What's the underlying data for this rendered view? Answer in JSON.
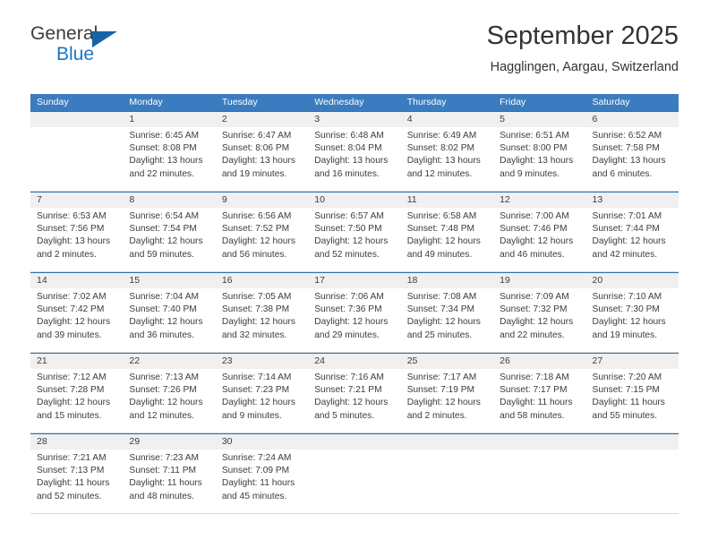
{
  "brand": {
    "name_top": "General",
    "name_bottom": "Blue",
    "triangle_icon": "triangle-icon",
    "color_dark": "#3a3a3a",
    "color_blue": "#1a75c4"
  },
  "header": {
    "title": "September 2025",
    "subtitle": "Hagglingen, Aargau, Switzerland"
  },
  "theme": {
    "header_bar": "#3a7cbf",
    "week_divider": "#2f6fae",
    "daynum_band": "#f0f0f0",
    "text": "#3c3c3c"
  },
  "weekdays": [
    "Sunday",
    "Monday",
    "Tuesday",
    "Wednesday",
    "Thursday",
    "Friday",
    "Saturday"
  ],
  "weeks": [
    {
      "days": [
        {
          "num": "",
          "sunrise": "",
          "sunset": "",
          "daylight_line1": "",
          "daylight_line2": ""
        },
        {
          "num": "1",
          "sunrise": "Sunrise: 6:45 AM",
          "sunset": "Sunset: 8:08 PM",
          "daylight_line1": "Daylight: 13 hours",
          "daylight_line2": "and 22 minutes."
        },
        {
          "num": "2",
          "sunrise": "Sunrise: 6:47 AM",
          "sunset": "Sunset: 8:06 PM",
          "daylight_line1": "Daylight: 13 hours",
          "daylight_line2": "and 19 minutes."
        },
        {
          "num": "3",
          "sunrise": "Sunrise: 6:48 AM",
          "sunset": "Sunset: 8:04 PM",
          "daylight_line1": "Daylight: 13 hours",
          "daylight_line2": "and 16 minutes."
        },
        {
          "num": "4",
          "sunrise": "Sunrise: 6:49 AM",
          "sunset": "Sunset: 8:02 PM",
          "daylight_line1": "Daylight: 13 hours",
          "daylight_line2": "and 12 minutes."
        },
        {
          "num": "5",
          "sunrise": "Sunrise: 6:51 AM",
          "sunset": "Sunset: 8:00 PM",
          "daylight_line1": "Daylight: 13 hours",
          "daylight_line2": "and 9 minutes."
        },
        {
          "num": "6",
          "sunrise": "Sunrise: 6:52 AM",
          "sunset": "Sunset: 7:58 PM",
          "daylight_line1": "Daylight: 13 hours",
          "daylight_line2": "and 6 minutes."
        }
      ]
    },
    {
      "days": [
        {
          "num": "7",
          "sunrise": "Sunrise: 6:53 AM",
          "sunset": "Sunset: 7:56 PM",
          "daylight_line1": "Daylight: 13 hours",
          "daylight_line2": "and 2 minutes."
        },
        {
          "num": "8",
          "sunrise": "Sunrise: 6:54 AM",
          "sunset": "Sunset: 7:54 PM",
          "daylight_line1": "Daylight: 12 hours",
          "daylight_line2": "and 59 minutes."
        },
        {
          "num": "9",
          "sunrise": "Sunrise: 6:56 AM",
          "sunset": "Sunset: 7:52 PM",
          "daylight_line1": "Daylight: 12 hours",
          "daylight_line2": "and 56 minutes."
        },
        {
          "num": "10",
          "sunrise": "Sunrise: 6:57 AM",
          "sunset": "Sunset: 7:50 PM",
          "daylight_line1": "Daylight: 12 hours",
          "daylight_line2": "and 52 minutes."
        },
        {
          "num": "11",
          "sunrise": "Sunrise: 6:58 AM",
          "sunset": "Sunset: 7:48 PM",
          "daylight_line1": "Daylight: 12 hours",
          "daylight_line2": "and 49 minutes."
        },
        {
          "num": "12",
          "sunrise": "Sunrise: 7:00 AM",
          "sunset": "Sunset: 7:46 PM",
          "daylight_line1": "Daylight: 12 hours",
          "daylight_line2": "and 46 minutes."
        },
        {
          "num": "13",
          "sunrise": "Sunrise: 7:01 AM",
          "sunset": "Sunset: 7:44 PM",
          "daylight_line1": "Daylight: 12 hours",
          "daylight_line2": "and 42 minutes."
        }
      ]
    },
    {
      "days": [
        {
          "num": "14",
          "sunrise": "Sunrise: 7:02 AM",
          "sunset": "Sunset: 7:42 PM",
          "daylight_line1": "Daylight: 12 hours",
          "daylight_line2": "and 39 minutes."
        },
        {
          "num": "15",
          "sunrise": "Sunrise: 7:04 AM",
          "sunset": "Sunset: 7:40 PM",
          "daylight_line1": "Daylight: 12 hours",
          "daylight_line2": "and 36 minutes."
        },
        {
          "num": "16",
          "sunrise": "Sunrise: 7:05 AM",
          "sunset": "Sunset: 7:38 PM",
          "daylight_line1": "Daylight: 12 hours",
          "daylight_line2": "and 32 minutes."
        },
        {
          "num": "17",
          "sunrise": "Sunrise: 7:06 AM",
          "sunset": "Sunset: 7:36 PM",
          "daylight_line1": "Daylight: 12 hours",
          "daylight_line2": "and 29 minutes."
        },
        {
          "num": "18",
          "sunrise": "Sunrise: 7:08 AM",
          "sunset": "Sunset: 7:34 PM",
          "daylight_line1": "Daylight: 12 hours",
          "daylight_line2": "and 25 minutes."
        },
        {
          "num": "19",
          "sunrise": "Sunrise: 7:09 AM",
          "sunset": "Sunset: 7:32 PM",
          "daylight_line1": "Daylight: 12 hours",
          "daylight_line2": "and 22 minutes."
        },
        {
          "num": "20",
          "sunrise": "Sunrise: 7:10 AM",
          "sunset": "Sunset: 7:30 PM",
          "daylight_line1": "Daylight: 12 hours",
          "daylight_line2": "and 19 minutes."
        }
      ]
    },
    {
      "days": [
        {
          "num": "21",
          "sunrise": "Sunrise: 7:12 AM",
          "sunset": "Sunset: 7:28 PM",
          "daylight_line1": "Daylight: 12 hours",
          "daylight_line2": "and 15 minutes."
        },
        {
          "num": "22",
          "sunrise": "Sunrise: 7:13 AM",
          "sunset": "Sunset: 7:26 PM",
          "daylight_line1": "Daylight: 12 hours",
          "daylight_line2": "and 12 minutes."
        },
        {
          "num": "23",
          "sunrise": "Sunrise: 7:14 AM",
          "sunset": "Sunset: 7:23 PM",
          "daylight_line1": "Daylight: 12 hours",
          "daylight_line2": "and 9 minutes."
        },
        {
          "num": "24",
          "sunrise": "Sunrise: 7:16 AM",
          "sunset": "Sunset: 7:21 PM",
          "daylight_line1": "Daylight: 12 hours",
          "daylight_line2": "and 5 minutes."
        },
        {
          "num": "25",
          "sunrise": "Sunrise: 7:17 AM",
          "sunset": "Sunset: 7:19 PM",
          "daylight_line1": "Daylight: 12 hours",
          "daylight_line2": "and 2 minutes."
        },
        {
          "num": "26",
          "sunrise": "Sunrise: 7:18 AM",
          "sunset": "Sunset: 7:17 PM",
          "daylight_line1": "Daylight: 11 hours",
          "daylight_line2": "and 58 minutes."
        },
        {
          "num": "27",
          "sunrise": "Sunrise: 7:20 AM",
          "sunset": "Sunset: 7:15 PM",
          "daylight_line1": "Daylight: 11 hours",
          "daylight_line2": "and 55 minutes."
        }
      ]
    },
    {
      "days": [
        {
          "num": "28",
          "sunrise": "Sunrise: 7:21 AM",
          "sunset": "Sunset: 7:13 PM",
          "daylight_line1": "Daylight: 11 hours",
          "daylight_line2": "and 52 minutes."
        },
        {
          "num": "29",
          "sunrise": "Sunrise: 7:23 AM",
          "sunset": "Sunset: 7:11 PM",
          "daylight_line1": "Daylight: 11 hours",
          "daylight_line2": "and 48 minutes."
        },
        {
          "num": "30",
          "sunrise": "Sunrise: 7:24 AM",
          "sunset": "Sunset: 7:09 PM",
          "daylight_line1": "Daylight: 11 hours",
          "daylight_line2": "and 45 minutes."
        },
        {
          "num": "",
          "sunrise": "",
          "sunset": "",
          "daylight_line1": "",
          "daylight_line2": ""
        },
        {
          "num": "",
          "sunrise": "",
          "sunset": "",
          "daylight_line1": "",
          "daylight_line2": ""
        },
        {
          "num": "",
          "sunrise": "",
          "sunset": "",
          "daylight_line1": "",
          "daylight_line2": ""
        },
        {
          "num": "",
          "sunrise": "",
          "sunset": "",
          "daylight_line1": "",
          "daylight_line2": ""
        }
      ]
    }
  ]
}
